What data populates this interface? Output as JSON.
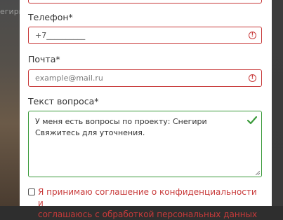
{
  "background": {
    "breadcrumb_fragment": "егири"
  },
  "form": {
    "phone": {
      "label": "Телефон*",
      "value": "+7__________"
    },
    "email": {
      "label": "Почта*",
      "placeholder": "example@mail.ru"
    },
    "question": {
      "label": "Текст вопроса*",
      "lines": [
        "У меня есть вопросы по проекту: Снегири",
        "Свяжитесь для уточнения."
      ]
    },
    "consent": {
      "line1": "Я принимаю соглашение о конфиденциальности и",
      "line2": "соглашаюсь с обработкой персональных данных"
    }
  },
  "colors": {
    "error": "#c83a3a",
    "success": "#3a9a3a"
  }
}
